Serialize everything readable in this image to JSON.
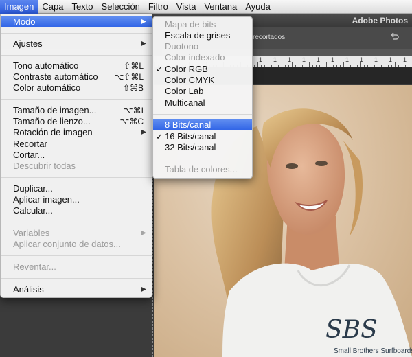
{
  "menubar": {
    "items": [
      {
        "label": "Imagen",
        "active": true
      },
      {
        "label": "Capa"
      },
      {
        "label": "Texto"
      },
      {
        "label": "Selección"
      },
      {
        "label": "Filtro"
      },
      {
        "label": "Vista"
      },
      {
        "label": "Ventana"
      },
      {
        "label": "Ayuda"
      }
    ]
  },
  "app": {
    "title": "Adobe Photos",
    "options_text": "recortados"
  },
  "ruler": {
    "labels": [
      "1",
      "1",
      "1",
      "1",
      "1",
      "1",
      "1",
      "1",
      "1",
      "1",
      "1"
    ]
  },
  "imagen_menu": {
    "items": [
      {
        "label": "Modo",
        "submenu": true
      },
      {
        "label": "Ajustes",
        "submenu": true
      },
      {
        "label": "Tono automático",
        "shortcut": "⇧⌘L"
      },
      {
        "label": "Contraste automático",
        "shortcut": "⌥⇧⌘L"
      },
      {
        "label": "Color automático",
        "shortcut": "⇧⌘B"
      },
      {
        "label": "Tamaño de imagen...",
        "shortcut": "⌥⌘I"
      },
      {
        "label": "Tamaño de lienzo...",
        "shortcut": "⌥⌘C"
      },
      {
        "label": "Rotación de imagen",
        "submenu": true
      },
      {
        "label": "Recortar"
      },
      {
        "label": "Cortar..."
      },
      {
        "label": "Descubrir todas",
        "disabled": true
      },
      {
        "label": "Duplicar..."
      },
      {
        "label": "Aplicar imagen..."
      },
      {
        "label": "Calcular..."
      },
      {
        "label": "Variables",
        "disabled": true,
        "submenu": true
      },
      {
        "label": "Aplicar conjunto de datos...",
        "disabled": true
      },
      {
        "label": "Reventar...",
        "disabled": true
      },
      {
        "label": "Análisis",
        "submenu": true
      }
    ]
  },
  "modo_menu": {
    "items": [
      {
        "label": "Mapa de bits",
        "disabled": true
      },
      {
        "label": "Escala de grises"
      },
      {
        "label": "Duotono",
        "disabled": true
      },
      {
        "label": "Color indexado",
        "disabled": true
      },
      {
        "label": "Color RGB",
        "checked": true
      },
      {
        "label": "Color CMYK"
      },
      {
        "label": "Color Lab"
      },
      {
        "label": "Multicanal"
      },
      {
        "label": "8 Bits/canal",
        "highlight": true
      },
      {
        "label": "16 Bits/canal",
        "checked": true
      },
      {
        "label": "32 Bits/canal"
      },
      {
        "label": "Tabla de colores...",
        "disabled": true
      }
    ]
  },
  "glyphs": {
    "submenu_arrow": "▶",
    "check": "✓"
  },
  "photo": {
    "shirt_text": "SBS",
    "shirt_subtext": "Small Brothers Surfboards"
  }
}
